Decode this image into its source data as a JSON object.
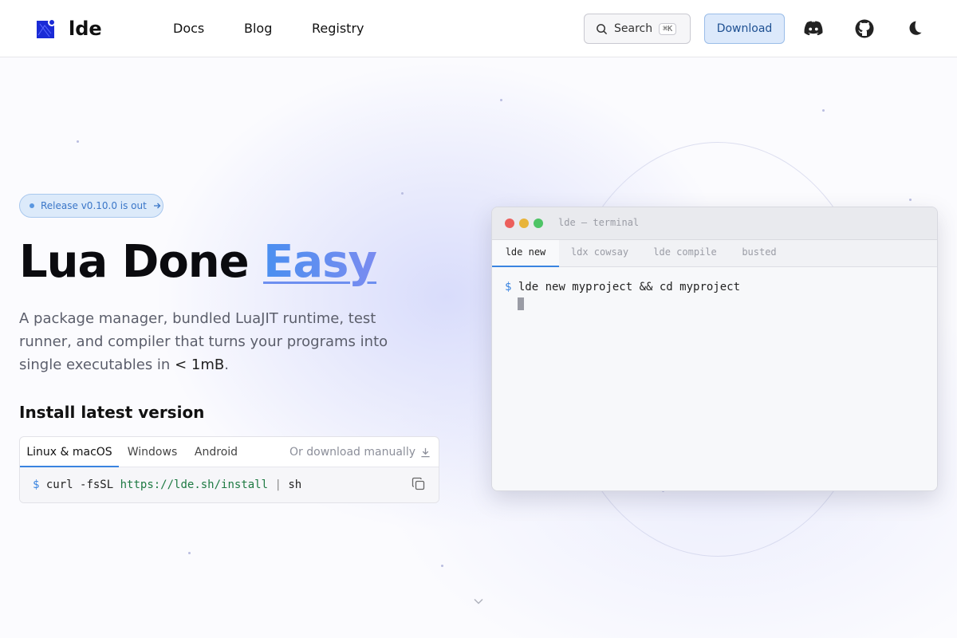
{
  "header": {
    "brand": "lde",
    "nav": [
      {
        "label": "Docs"
      },
      {
        "label": "Blog"
      },
      {
        "label": "Registry"
      }
    ],
    "search_label": "Search",
    "search_shortcut": "⌘K",
    "download_label": "Download",
    "icons": [
      "discord-icon",
      "github-icon",
      "moon-icon"
    ]
  },
  "hero": {
    "badge": "Release v0.10.0 is out",
    "title_main": "Lua Done ",
    "title_accent": "Easy",
    "subtitle_a": "A package manager, bundled LuaJIT runtime, test runner, and compiler that turns your programs into single executables in ",
    "subtitle_b": "< 1mB",
    "subtitle_c": "."
  },
  "install": {
    "heading": "Install latest version",
    "tabs": [
      {
        "label": "Linux & macOS",
        "active": true
      },
      {
        "label": "Windows",
        "active": false
      },
      {
        "label": "Android",
        "active": false
      }
    ],
    "manual_link": "Or download manually",
    "command": {
      "prompt": "$",
      "cmd": "curl -fsSL",
      "url": "https://lde.sh/install",
      "pipe": "|",
      "shell": "sh"
    }
  },
  "terminal": {
    "title": "lde — terminal",
    "tabs": [
      {
        "label": "lde new",
        "active": true
      },
      {
        "label": "ldx cowsay",
        "active": false
      },
      {
        "label": "lde compile",
        "active": false
      },
      {
        "label": "busted",
        "active": false
      }
    ],
    "prompt": "$",
    "line": "lde new myproject && cd myproject"
  },
  "colors": {
    "accent": "#3a84e0",
    "download_bg": "#dce9fb",
    "traffic_red": "#ec5f5c",
    "traffic_yellow": "#e8b43a",
    "traffic_green": "#4ec466"
  }
}
